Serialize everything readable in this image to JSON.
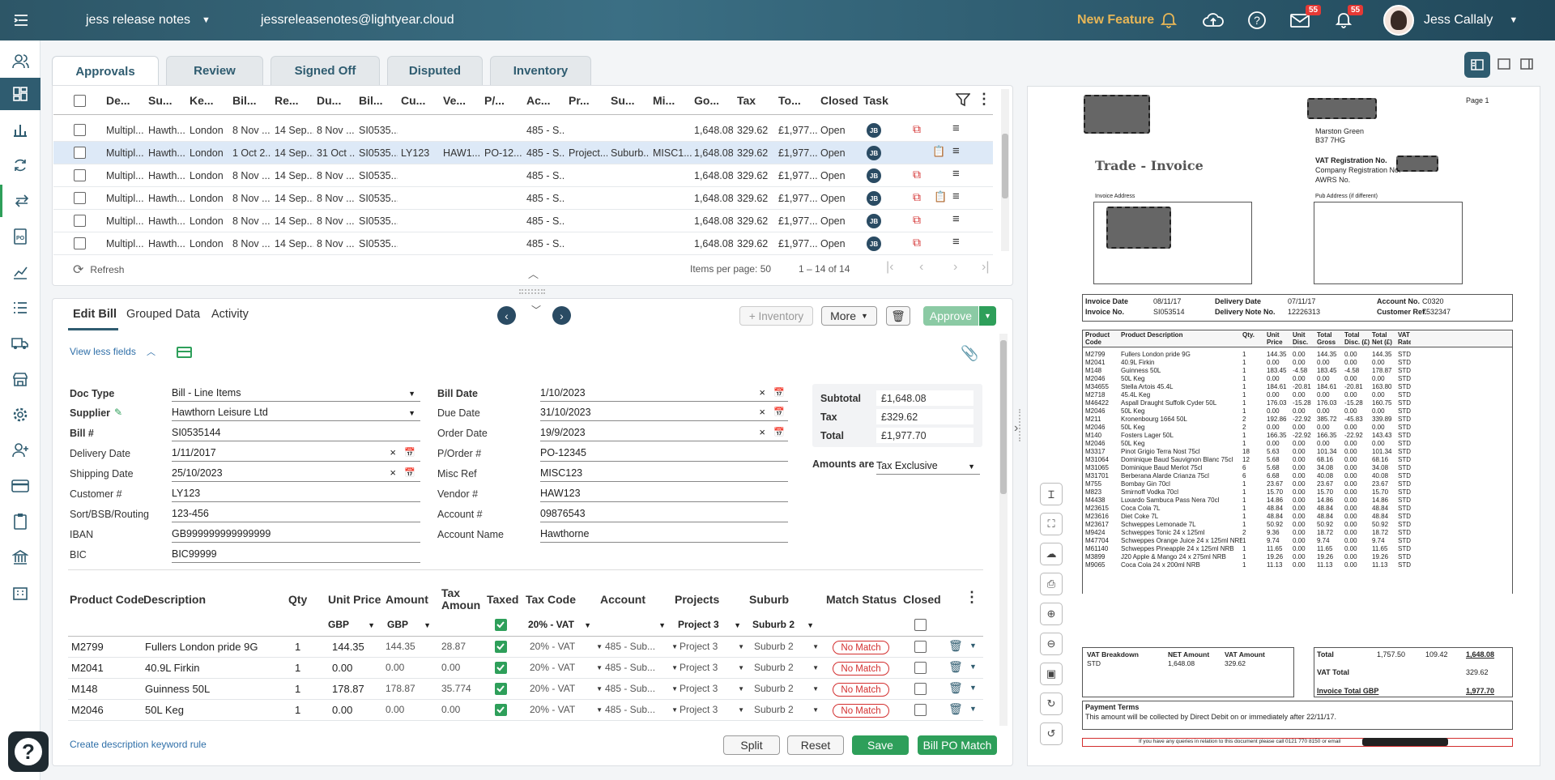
{
  "topbar": {
    "org": "jess release notes",
    "email": "jessreleasenotes@lightyear.cloud",
    "new_feature": "New Feature",
    "mail_badge": "55",
    "notif_badge": "55",
    "user": "Jess Callaly"
  },
  "tabs": [
    "Approvals",
    "Review",
    "Signed Off",
    "Disputed",
    "Inventory"
  ],
  "grid": {
    "headers": [
      "De...",
      "Su...",
      "Ke...",
      "Bil...",
      "Re...",
      "Du...",
      "Bil...",
      "Cu...",
      "Ve...",
      "P/...",
      "Ac...",
      "Pr...",
      "Su...",
      "Mi...",
      "Go...",
      "Tax",
      "To...",
      "Closed",
      "Task"
    ],
    "rows": [
      {
        "c": [
          "Multipl...",
          "Hawth...",
          "London",
          "8 Nov ...",
          "14 Sep...",
          "8 Nov ...",
          "SI0535...",
          "",
          "",
          "",
          "485 - S...",
          "",
          "",
          "",
          "1,648.08",
          "329.62",
          "£1,977...",
          "Open"
        ],
        "task": "JB"
      },
      {
        "c": [
          "Multipl...",
          "Hawth...",
          "London",
          "1 Oct 2...",
          "14 Sep...",
          "31 Oct ...",
          "SI0535...",
          "LY123",
          "HAW1...",
          "PO-12...",
          "485 - S...",
          "Project...",
          "Suburb...",
          "MISC1...",
          "1,648.08",
          "329.62",
          "£1,977...",
          "Open"
        ],
        "task": "JB"
      },
      {
        "c": [
          "Multipl...",
          "Hawth...",
          "London",
          "8 Nov ...",
          "14 Sep...",
          "8 Nov ...",
          "SI0535...",
          "",
          "",
          "",
          "485 - S...",
          "",
          "",
          "",
          "1,648.08",
          "329.62",
          "£1,977...",
          "Open"
        ],
        "task": "JB"
      },
      {
        "c": [
          "Multipl...",
          "Hawth...",
          "London",
          "8 Nov ...",
          "14 Sep...",
          "8 Nov ...",
          "SI0535...",
          "",
          "",
          "",
          "485 - S...",
          "",
          "",
          "",
          "1,648.08",
          "329.62",
          "£1,977...",
          "Open"
        ],
        "task": "JB"
      },
      {
        "c": [
          "Multipl...",
          "Hawth...",
          "London",
          "8 Nov ...",
          "14 Sep...",
          "8 Nov ...",
          "SI0535...",
          "",
          "",
          "",
          "485 - S...",
          "",
          "",
          "",
          "1,648.08",
          "329.62",
          "£1,977...",
          "Open"
        ],
        "task": "JB"
      },
      {
        "c": [
          "Multipl...",
          "Hawth...",
          "London",
          "8 Nov ...",
          "14 Sep...",
          "8 Nov ...",
          "SI0535...",
          "",
          "",
          "",
          "485 - S...",
          "",
          "",
          "",
          "1,648.08",
          "329.62",
          "£1,977...",
          "Open"
        ],
        "task": "JB"
      }
    ],
    "refresh": "Refresh",
    "per_page": "Items per page: 50",
    "range": "1 – 14 of 14"
  },
  "edit": {
    "tabs": [
      "Edit Bill",
      "Grouped Data",
      "Activity"
    ],
    "inventory_btn": "+ Inventory",
    "more_btn": "More",
    "approve_btn": "Approve",
    "view_less": "View less fields",
    "left_fields": [
      {
        "label": "Doc Type",
        "value": "Bill - Line Items"
      },
      {
        "label": "Supplier",
        "value": "Hawthorn Leisure Ltd"
      },
      {
        "label": "Bill #",
        "value": "SI0535144"
      },
      {
        "label": "Delivery Date",
        "value": "1/11/2017"
      },
      {
        "label": "Shipping Date",
        "value": "25/10/2023"
      },
      {
        "label": "Customer #",
        "value": "LY123"
      },
      {
        "label": "Sort/BSB/Routing",
        "value": "123-456"
      },
      {
        "label": "IBAN",
        "value": "GB999999999999999"
      },
      {
        "label": "BIC",
        "value": "BIC99999"
      }
    ],
    "mid_fields": [
      {
        "label": "Bill Date",
        "value": "1/10/2023"
      },
      {
        "label": "Due Date",
        "value": "31/10/2023"
      },
      {
        "label": "Order Date",
        "value": "19/9/2023"
      },
      {
        "label": "P/Order #",
        "value": "PO-12345"
      },
      {
        "label": "Misc Ref",
        "value": "MISC123"
      },
      {
        "label": "Vendor #",
        "value": "HAW123"
      },
      {
        "label": "Account #",
        "value": "09876543"
      },
      {
        "label": "Account Name",
        "value": "Hawthorne"
      }
    ],
    "totals": [
      {
        "label": "Subtotal",
        "value": "£1,648.08"
      },
      {
        "label": "Tax",
        "value": "£329.62"
      },
      {
        "label": "Total",
        "value": "£1,977.70"
      }
    ],
    "amounts_are_label": "Amounts are",
    "amounts_are": "Tax Exclusive",
    "line_headers": [
      "Product Code",
      "Description",
      "Qty",
      "Unit Price",
      "Amount",
      "Tax Amoun",
      "Taxed",
      "Tax Code",
      "Account",
      "Projects",
      "Suburb",
      "Match Status",
      "Closed"
    ],
    "filters": {
      "unit_price": "GBP",
      "amount": "GBP",
      "tax_code": "20% - VAT",
      "projects": "Project 3",
      "suburb": "Suburb 2"
    },
    "lines": [
      {
        "code": "M2799",
        "desc": "Fullers London pride 9G",
        "qty": "1",
        "unit": "144.35",
        "amount": "144.35",
        "tax": "28.87",
        "taxcode": "20% - VAT",
        "account": "485 - Sub...",
        "project": "Project 3",
        "suburb": "Suburb 2",
        "match": "No Match"
      },
      {
        "code": "M2041",
        "desc": "40.9L Firkin",
        "qty": "1",
        "unit": "0.00",
        "amount": "0.00",
        "tax": "0.00",
        "taxcode": "20% - VAT",
        "account": "485 - Sub...",
        "project": "Project 3",
        "suburb": "Suburb 2",
        "match": "No Match"
      },
      {
        "code": "M148",
        "desc": "Guinness  50L",
        "qty": "1",
        "unit": "178.87",
        "amount": "178.87",
        "tax": "35.774",
        "taxcode": "20% - VAT",
        "account": "485 - Sub...",
        "project": "Project 3",
        "suburb": "Suburb 2",
        "match": "No Match"
      },
      {
        "code": "M2046",
        "desc": "50L Keg",
        "qty": "1",
        "unit": "0.00",
        "amount": "0.00",
        "tax": "0.00",
        "taxcode": "20% - VAT",
        "account": "485 - Sub...",
        "project": "Project 3",
        "suburb": "Suburb 2",
        "match": "No Match"
      }
    ],
    "keyword_link": "Create description keyword rule",
    "split_btn": "Split",
    "reset_btn": "Reset",
    "save_btn": "Save",
    "po_btn": "Bill PO Match"
  },
  "invoice": {
    "page": "Page  1",
    "address": "Marston Green",
    "postcode": "B37 7HG",
    "title": "Trade - Invoice",
    "vat_lines": [
      "VAT Registration No.",
      "Company Registration No.",
      "AWRS No."
    ],
    "invoice_address": "Invoice Address",
    "pub_address": "Pub Address (if different)",
    "info": [
      [
        "Invoice Date",
        "08/11/17",
        "Delivery Date",
        "07/11/17",
        "Account No.",
        "C0320"
      ],
      [
        "Invoice No.",
        "SI053514",
        "Delivery Note No.",
        "12226313",
        "Customer Ref.",
        "7532347"
      ]
    ],
    "cols": [
      "Product Code",
      "Product Description",
      "Qty.",
      "Unit Price",
      "Unit Disc. (£)",
      "Total Gross (£)",
      "Total Disc. (£)",
      "Total Net (£)",
      "VAT Rate"
    ],
    "items": [
      [
        "M2799",
        "Fullers London pride 9G",
        "1",
        "144.35",
        "0.00",
        "144.35",
        "0.00",
        "144.35",
        "STD"
      ],
      [
        "M2041",
        "40.9L Firkin",
        "1",
        "0.00",
        "0.00",
        "0.00",
        "0.00",
        "0.00",
        "STD"
      ],
      [
        "M148",
        "Guinness 50L",
        "1",
        "183.45",
        "-4.58",
        "183.45",
        "-4.58",
        "178.87",
        "STD"
      ],
      [
        "M2046",
        "50L Keg",
        "1",
        "0.00",
        "0.00",
        "0.00",
        "0.00",
        "0.00",
        "STD"
      ],
      [
        "M34655",
        "Stella Artois 45.4L",
        "1",
        "184.61",
        "-20.81",
        "184.61",
        "-20.81",
        "163.80",
        "STD"
      ],
      [
        "M2718",
        "45.4L Keg",
        "1",
        "0.00",
        "0.00",
        "0.00",
        "0.00",
        "0.00",
        "STD"
      ],
      [
        "M46422",
        "Aspall Draught Suffolk Cyder 50L",
        "1",
        "176.03",
        "-15.28",
        "176.03",
        "-15.28",
        "160.75",
        "STD"
      ],
      [
        "M2046",
        "50L Keg",
        "1",
        "0.00",
        "0.00",
        "0.00",
        "0.00",
        "0.00",
        "STD"
      ],
      [
        "M211",
        "Kronenbourg 1664 50L",
        "2",
        "192.86",
        "-22.92",
        "385.72",
        "-45.83",
        "339.89",
        "STD"
      ],
      [
        "M2046",
        "50L Keg",
        "2",
        "0.00",
        "0.00",
        "0.00",
        "0.00",
        "0.00",
        "STD"
      ],
      [
        "M140",
        "Fosters Lager 50L",
        "1",
        "166.35",
        "-22.92",
        "166.35",
        "-22.92",
        "143.43",
        "STD"
      ],
      [
        "M2046",
        "50L Keg",
        "1",
        "0.00",
        "0.00",
        "0.00",
        "0.00",
        "0.00",
        "STD"
      ],
      [
        "M3317",
        "Pinot Grigio Terra Nost 75cl",
        "18",
        "5.63",
        "0.00",
        "101.34",
        "0.00",
        "101.34",
        "STD"
      ],
      [
        "M31064",
        "Dominique Baud Sauvignon Blanc 75cl",
        "12",
        "5.68",
        "0.00",
        "68.16",
        "0.00",
        "68.16",
        "STD"
      ],
      [
        "M31065",
        "Dominique Baud Merlot 75cl",
        "6",
        "5.68",
        "0.00",
        "34.08",
        "0.00",
        "34.08",
        "STD"
      ],
      [
        "M31701",
        "Berberana Alarde Crianza 75cl",
        "6",
        "6.68",
        "0.00",
        "40.08",
        "0.00",
        "40.08",
        "STD"
      ],
      [
        "M755",
        "Bombay Gin 70cl",
        "1",
        "23.67",
        "0.00",
        "23.67",
        "0.00",
        "23.67",
        "STD"
      ],
      [
        "M823",
        "Smirnoff Vodka 70cl",
        "1",
        "15.70",
        "0.00",
        "15.70",
        "0.00",
        "15.70",
        "STD"
      ],
      [
        "M4438",
        "Luxardo Sambuca Pass Nera 70cl",
        "1",
        "14.86",
        "0.00",
        "14.86",
        "0.00",
        "14.86",
        "STD"
      ],
      [
        "M23615",
        "Coca Cola 7L",
        "1",
        "48.84",
        "0.00",
        "48.84",
        "0.00",
        "48.84",
        "STD"
      ],
      [
        "M23616",
        "Diet Coke 7L",
        "1",
        "48.84",
        "0.00",
        "48.84",
        "0.00",
        "48.84",
        "STD"
      ],
      [
        "M23617",
        "Schweppes Lemonade 7L",
        "1",
        "50.92",
        "0.00",
        "50.92",
        "0.00",
        "50.92",
        "STD"
      ],
      [
        "M9424",
        "Schweppes Tonic 24 x 125ml",
        "2",
        "9.36",
        "0.00",
        "18.72",
        "0.00",
        "18.72",
        "STD"
      ],
      [
        "M47704",
        "Schweppes Orange Juice 24 x 125ml NRB",
        "1",
        "9.74",
        "0.00",
        "9.74",
        "0.00",
        "9.74",
        "STD"
      ],
      [
        "M61140",
        "Schweppes Pineapple 24 x 125ml NRB",
        "1",
        "11.65",
        "0.00",
        "11.65",
        "0.00",
        "11.65",
        "STD"
      ],
      [
        "M3899",
        "J20 Apple & Mango 24 x 275ml NRB",
        "1",
        "19.26",
        "0.00",
        "19.26",
        "0.00",
        "19.26",
        "STD"
      ],
      [
        "M9065",
        "Coca Cola 24 x 200ml NRB",
        "1",
        "11.13",
        "0.00",
        "11.13",
        "0.00",
        "11.13",
        "STD"
      ]
    ],
    "vat_breakdown": [
      "VAT Breakdown",
      "NET Amount",
      "VAT Amount"
    ],
    "vat_row": [
      "STD",
      "1,648.08",
      "329.62"
    ],
    "total_rows": [
      [
        "Total",
        "1,757.50",
        "109.42",
        "1,648.08"
      ],
      [
        "VAT Total",
        "",
        "",
        "329.62"
      ],
      [
        "Invoice Total GBP",
        "",
        "",
        "1,977.70"
      ]
    ],
    "payment_terms": "Payment Terms",
    "payment_text": "This amount will be collected by Direct Debit  on or immediately after 22/11/17.",
    "footer": "If you have any queries in relation to this document please call 0121 770 8150 or email"
  }
}
